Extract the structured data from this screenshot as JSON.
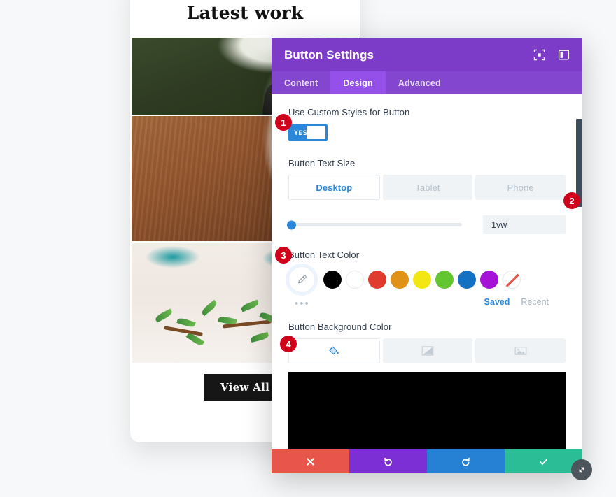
{
  "site": {
    "heading": "Latest work",
    "view_all_label": "View All",
    "photos": [
      {
        "alt": "bride holding white bouquet"
      },
      {
        "alt": "bride black heels on wooden floor"
      },
      {
        "alt": "green eucalyptus table centerpiece"
      }
    ]
  },
  "modal": {
    "title": "Button Settings",
    "header_icons": [
      {
        "name": "fullscreen-icon"
      },
      {
        "name": "layout-panel-icon"
      }
    ],
    "tabs": [
      {
        "label": "Content",
        "active": false
      },
      {
        "label": "Design",
        "active": true
      },
      {
        "label": "Advanced",
        "active": false
      }
    ],
    "custom_styles": {
      "label": "Use Custom Styles for Button",
      "toggle_value": "YES",
      "toggle_on": true,
      "accent": "#2b87da"
    },
    "text_size": {
      "label": "Button Text Size",
      "devices": [
        "Desktop",
        "Tablet",
        "Phone"
      ],
      "active_device": "Desktop",
      "value": "1vw",
      "slider_percent": 0
    },
    "text_color": {
      "label": "Button Text Color",
      "eyedropper": "eyedropper-icon",
      "swatches": [
        {
          "name": "black",
          "hex": "#000000"
        },
        {
          "name": "white",
          "hex": "#ffffff"
        },
        {
          "name": "red",
          "hex": "#e03b2f"
        },
        {
          "name": "orange",
          "hex": "#df9118"
        },
        {
          "name": "yellow",
          "hex": "#f2e713"
        },
        {
          "name": "green",
          "hex": "#63c52f"
        },
        {
          "name": "blue",
          "hex": "#1470c0"
        },
        {
          "name": "purple",
          "hex": "#a514d6"
        },
        {
          "name": "none",
          "hex": "transparent"
        }
      ],
      "more_dots": "•••",
      "saved_label": "Saved",
      "recent_label": "Recent"
    },
    "background_color": {
      "label": "Button Background Color",
      "types": [
        {
          "name": "solid-color-icon",
          "active": true
        },
        {
          "name": "gradient-icon",
          "active": false
        },
        {
          "name": "image-icon",
          "active": false
        }
      ],
      "current_value": "#000000"
    },
    "footer_actions": [
      {
        "name": "cancel-button",
        "icon": "close-icon",
        "color": "#e8564b"
      },
      {
        "name": "undo-button",
        "icon": "undo-icon",
        "color": "#7c2fd4"
      },
      {
        "name": "redo-button",
        "icon": "redo-icon",
        "color": "#2680d4"
      },
      {
        "name": "save-button",
        "icon": "check-icon",
        "color": "#2bbd95"
      }
    ],
    "resize_handle": "resize-icon"
  },
  "annotations": [
    {
      "number": "1"
    },
    {
      "number": "2"
    },
    {
      "number": "3"
    },
    {
      "number": "4"
    }
  ]
}
